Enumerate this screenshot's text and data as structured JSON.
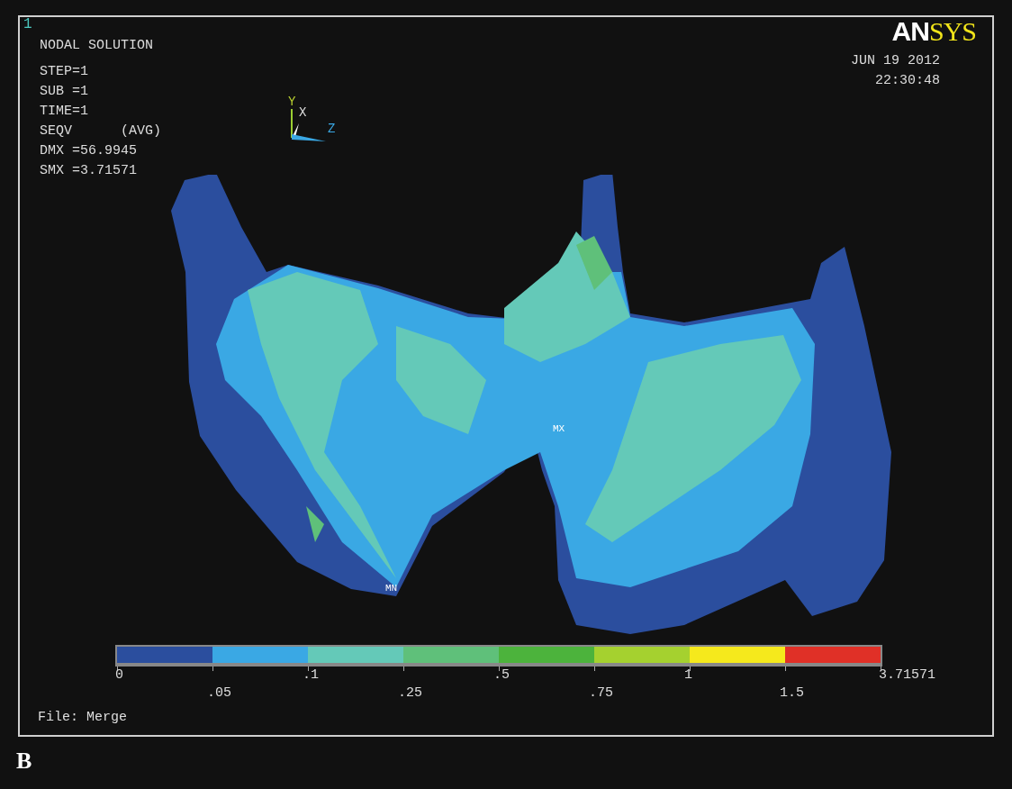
{
  "viewport": {
    "window_number": "1",
    "title": "NODAL SOLUTION",
    "info_lines": [
      "STEP=1",
      "SUB =1",
      "TIME=1",
      "SEQV      (AVG)",
      "DMX =56.9945",
      "SMX =3.71571"
    ],
    "axes": [
      {
        "label": "Y"
      },
      {
        "label": "X"
      },
      {
        "label": "Z"
      }
    ],
    "logo": {
      "part_1": "AN",
      "part_2": "SYS"
    },
    "date": "JUN 19 2012",
    "time": "22:30:48",
    "markers": [
      {
        "label": "MX"
      },
      {
        "label": "MN"
      }
    ],
    "legend": {
      "bands": [
        {
          "color": "#2b4e9e"
        },
        {
          "color": "#3aa8e4"
        },
        {
          "color": "#64c9b8"
        },
        {
          "color": "#5fc07a"
        },
        {
          "color": "#4cb33c"
        },
        {
          "color": "#a5d12f"
        },
        {
          "color": "#f5e91c"
        },
        {
          "color": "#e03027"
        }
      ],
      "ticks": [
        "0",
        ".05",
        ".1",
        ".25",
        ".5",
        ".75",
        "1",
        "1.5",
        "3.71571"
      ]
    },
    "file_label": "File: Merge"
  },
  "panel_label": "B"
}
